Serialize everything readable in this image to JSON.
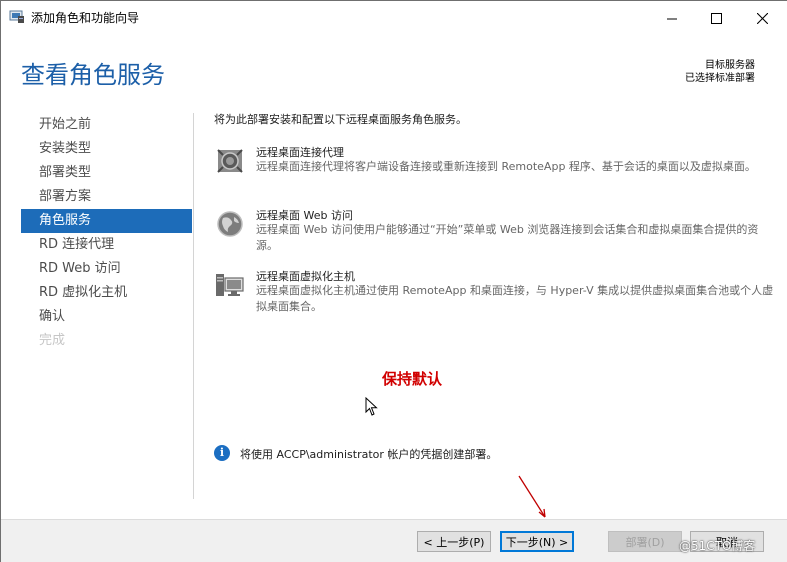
{
  "window": {
    "title": "添加角色和功能向导",
    "icons": {
      "app": "server-manager-icon",
      "minimize": "minimize-icon",
      "maximize": "maximize-icon",
      "close": "close-icon"
    }
  },
  "header": {
    "page_title": "查看角色服务",
    "dest_label": "目标服务器",
    "dest_value": "已选择标准部署"
  },
  "nav": {
    "items": [
      {
        "label": "开始之前",
        "state": "normal"
      },
      {
        "label": "安装类型",
        "state": "normal"
      },
      {
        "label": "部署类型",
        "state": "normal"
      },
      {
        "label": "部署方案",
        "state": "normal"
      },
      {
        "label": "角色服务",
        "state": "active"
      },
      {
        "label": "RD 连接代理",
        "state": "normal"
      },
      {
        "label": "RD Web 访问",
        "state": "normal"
      },
      {
        "label": "RD 虚拟化主机",
        "state": "normal"
      },
      {
        "label": "确认",
        "state": "normal"
      },
      {
        "label": "完成",
        "state": "disabled"
      }
    ]
  },
  "main": {
    "intro": "将为此部署安装和配置以下远程桌面服务角色服务。",
    "services": [
      {
        "icon": "connection-broker-icon",
        "name": "远程桌面连接代理",
        "desc": "远程桌面连接代理将客户端设备连接或重新连接到 RemoteApp 程序、基于会话的桌面以及虚拟桌面。"
      },
      {
        "icon": "web-access-globe-icon",
        "name": "远程桌面 Web 访问",
        "desc": "远程桌面 Web 访问使用户能够通过“开始”菜单或 Web 浏览器连接到会话集合和虚拟桌面集合提供的资源。"
      },
      {
        "icon": "virtualization-host-icon",
        "name": "远程桌面虚拟化主机",
        "desc": "远程桌面虚拟化主机通过使用 RemoteApp 和桌面连接，与 Hyper-V 集成以提供虚拟桌面集合池或个人虚拟桌面集合。"
      }
    ],
    "annotation": "保持默认",
    "info_text": "将使用 ACCP\\administrator 帐户的凭据创建部署。"
  },
  "footer": {
    "prev_label": "< 上一步(P)",
    "next_label": "下一步(N) >",
    "deploy_label": "部署(D)",
    "cancel_label": "取消"
  },
  "watermark": "@51CTO博客",
  "colors": {
    "accent": "#1d6cb9",
    "title_blue": "#1c5fa8",
    "annotation_red": "#d10000"
  }
}
